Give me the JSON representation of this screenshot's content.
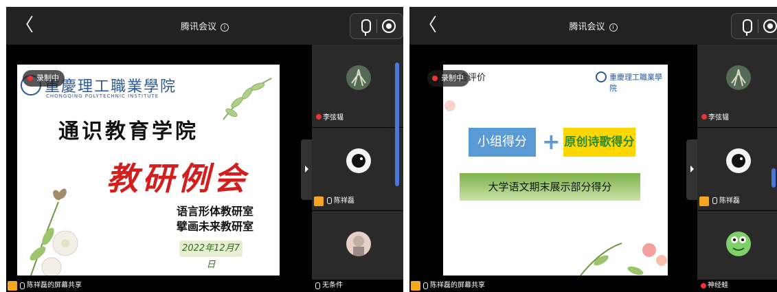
{
  "left": {
    "title": "腾讯会议",
    "recording": "录制中",
    "school_name": "重慶理工職業學院",
    "school_en": "CHONGQING POLYTECHNIC INSTITUTE",
    "slide_heading": "通识教育学院",
    "slide_main": "教研例会",
    "slide_line1": "语言形体教研室",
    "slide_line2": "擘画未来教研室",
    "slide_date": "2022年12月7日",
    "participants": [
      {
        "name": "李弦韫"
      },
      {
        "name": "陈祥磊"
      },
      {
        "name": "无条件"
      }
    ],
    "screen_share": "陈祥磊的屏幕共享"
  },
  "right": {
    "title": "腾讯会议",
    "recording": "录制中",
    "slide_corner": "综合评价",
    "school_name": "重慶理工職業學院",
    "box1": "小组得分",
    "plus": "+",
    "box2": "原创诗歌得分",
    "subtitle": "大学语文期末展示部分得分",
    "participants": [
      {
        "name": "李弦韫"
      },
      {
        "name": "陈祥磊"
      },
      {
        "name": "神经蛙"
      }
    ],
    "screen_share": "陈祥磊的屏幕共享"
  },
  "colors": {
    "accent_blue": "#4a78d8",
    "box1_blue": "#5b9bd5",
    "box2_yellow": "#ffd700",
    "box2_text": "#2e8b2e",
    "bar_green": "#7db14a",
    "main_red": "#d41e1e"
  }
}
